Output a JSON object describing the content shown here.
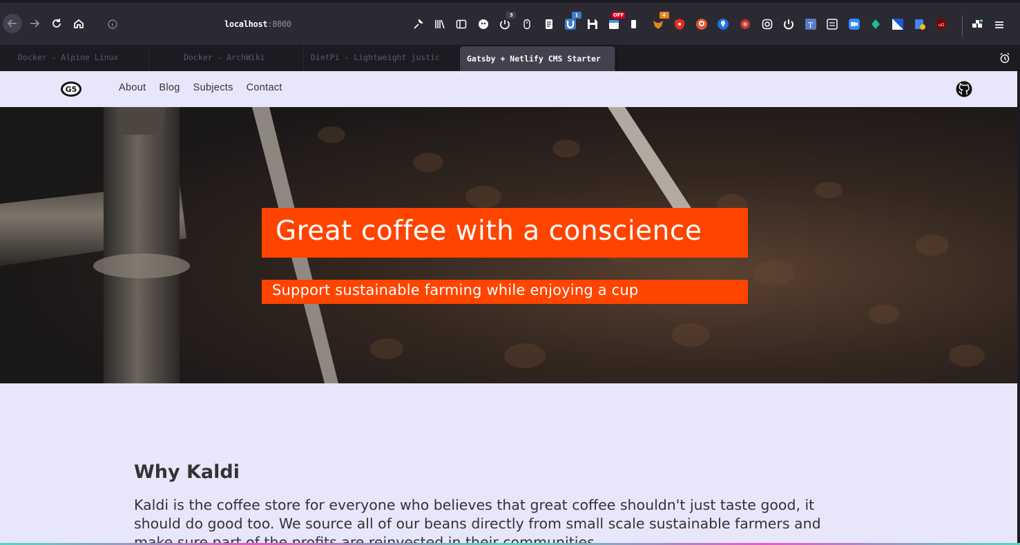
{
  "browser": {
    "url_host": "localhost",
    "url_port": ":8000",
    "tabs": [
      {
        "title": "Docker - Alpine Linux"
      },
      {
        "title": "Docker - ArchWiki"
      },
      {
        "title": "DietPi - Lightweight justic"
      },
      {
        "title": "Gatsby + Netlify CMS Starter"
      }
    ],
    "active_tab_index": 3,
    "extension_badges": {
      "first": "3",
      "second": "1",
      "off": "OFF",
      "fourth": "4"
    },
    "icons": [
      "back-icon",
      "forward-icon",
      "reload-icon",
      "home-icon",
      "info-icon",
      "wrench-icon",
      "library-icon",
      "sidebar-icon",
      "extension-icons",
      "alarm-icon",
      "menu-icon"
    ]
  },
  "site": {
    "logo_text": "G5",
    "nav": [
      "About",
      "Blog",
      "Subjects",
      "Contact"
    ],
    "hero": {
      "title": "Great coffee with a conscience",
      "subtitle": "Support sustainable farming while enjoying a cup"
    },
    "why": {
      "heading": "Why Kaldi",
      "body": "Kaldi is the coffee store for everyone who believes that great coffee shouldn't just taste good, it should do good too. We source all of our beans directly from small scale sustainable farmers and make sure part of the profits are reinvested in their communities."
    }
  },
  "colors": {
    "accent": "#ff4400",
    "page_bg": "#e8e6fb",
    "chrome_bg": "#2b2a33"
  }
}
